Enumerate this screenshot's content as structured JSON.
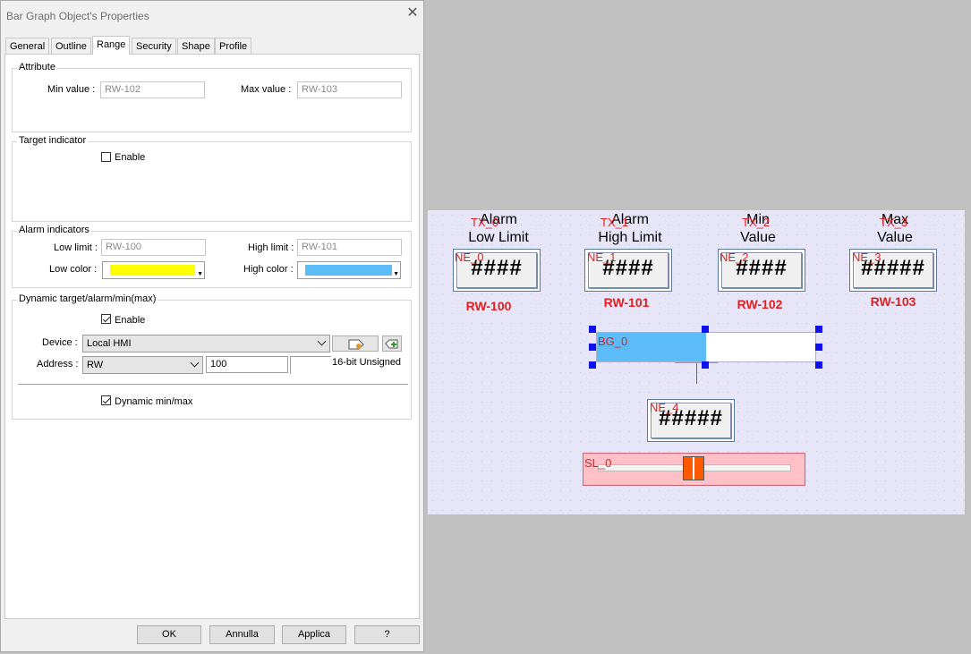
{
  "dialog": {
    "title": "Bar Graph Object's Properties",
    "tabs": [
      "General",
      "Outline",
      "Range",
      "Security",
      "Shape",
      "Profile"
    ],
    "active_tab": "Range"
  },
  "attribute": {
    "group_label": "Attribute",
    "min_label": "Min value :",
    "min_value": "RW-102",
    "max_label": "Max value :",
    "max_value": "RW-103"
  },
  "target": {
    "group_label": "Target indicator",
    "enable_label": "Enable",
    "enabled": false
  },
  "alarm": {
    "group_label": "Alarm indicators",
    "low_limit_label": "Low limit :",
    "low_limit_value": "RW-100",
    "high_limit_label": "High limit :",
    "high_limit_value": "RW-101",
    "low_color_label": "Low color :",
    "low_color": "#ffff00",
    "high_color_label": "High color :",
    "high_color": "#5bbcf7"
  },
  "dynamic": {
    "group_label": "Dynamic target/alarm/min(max)",
    "enable_label": "Enable",
    "enabled": true,
    "device_label": "Device :",
    "device_value": "Local HMI",
    "address_label": "Address :",
    "address_type": "RW",
    "address_value": "100",
    "data_format": "16-bit Unsigned",
    "dynamic_minmax_label": "Dynamic min/max",
    "dynamic_minmax": true
  },
  "buttons": {
    "ok": "OK",
    "cancel": "Annulla",
    "apply": "Applica",
    "help": "?"
  },
  "canvas": {
    "captions": [
      {
        "tag": "TX_0",
        "line1": "Alarm",
        "line2": "Low Limit"
      },
      {
        "tag": "TX_1",
        "line1": "Alarm",
        "line2": "High Limit"
      },
      {
        "tag": "TX_2",
        "line1": "Min",
        "line2": "Value"
      },
      {
        "tag": "TX_3",
        "line1": "Max",
        "line2": "Value"
      }
    ],
    "numerics": [
      {
        "tag": "NE_0",
        "display": "####",
        "address": "RW-100"
      },
      {
        "tag": "NE_1",
        "display": "####",
        "address": "RW-101"
      },
      {
        "tag": "NE_2",
        "display": "####",
        "address": "RW-102"
      },
      {
        "tag": "NE_3",
        "display": "#####",
        "address": "RW-103"
      }
    ],
    "bar_graph": {
      "tag": "BG_0",
      "fill_fraction": 0.5,
      "fill_color": "#5bbcf7"
    },
    "numeric4": {
      "tag": "NE_4",
      "display": "#####"
    },
    "slider": {
      "tag": "SL_0",
      "thumb_color": "#ff5a00"
    }
  }
}
